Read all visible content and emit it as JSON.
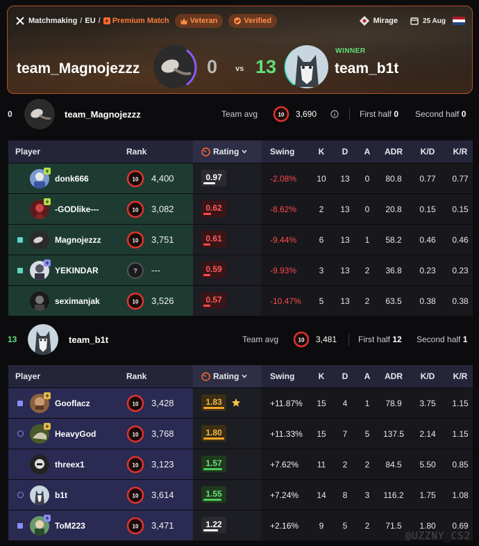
{
  "breadcrumb": {
    "items": [
      "Matchmaking",
      "EU"
    ],
    "premium": "Premium Match",
    "badges": [
      "Veteran",
      "Verified"
    ]
  },
  "match_info": {
    "map": "Mirage",
    "date": "25 Aug",
    "region_flag": "netherlands-flag"
  },
  "scoreboard": {
    "team1_name": "team_Magnojezzz",
    "team1_score": "0",
    "vs": "vs",
    "team2_name": "team_b1t",
    "team2_score": "13",
    "winner_label": "WINNER"
  },
  "team1": {
    "score": "0",
    "name": "team_Magnojezzz",
    "avg_label": "Team avg",
    "avg_level": "10",
    "avg_value": "3,690",
    "first_half_label": "First half",
    "first_half": "0",
    "second_half_label": "Second half",
    "second_half": "0"
  },
  "team2": {
    "score": "13",
    "name": "team_b1t",
    "avg_label": "Team avg",
    "avg_level": "10",
    "avg_value": "3,481",
    "first_half_label": "First half",
    "first_half": "12",
    "second_half_label": "Second half",
    "second_half": "1"
  },
  "columns": {
    "player": "Player",
    "rank": "Rank",
    "rating": "Rating",
    "swing": "Swing",
    "k": "K",
    "d": "D",
    "a": "A",
    "adr": "ADR",
    "kd": "K/D",
    "kr": "K/R"
  },
  "team1_players": [
    {
      "name": "donk666",
      "level": "10",
      "elo": "4,400",
      "rating": "0.97",
      "rating_fraction": 0.55,
      "swing": "-2.08%",
      "k": "10",
      "d": "13",
      "a": "0",
      "adr": "80.8",
      "kd": "0.77",
      "kr": "0.77"
    },
    {
      "name": "-GODlike---",
      "level": "10",
      "elo": "3,082",
      "rating": "0.62",
      "rating_fraction": 0.35,
      "swing": "-8.62%",
      "k": "2",
      "d": "13",
      "a": "0",
      "adr": "20.8",
      "kd": "0.15",
      "kr": "0.15"
    },
    {
      "name": "Magnojezzz",
      "level": "10",
      "elo": "3,751",
      "rating": "0.61",
      "rating_fraction": 0.34,
      "swing": "-9.44%",
      "k": "6",
      "d": "13",
      "a": "1",
      "adr": "58.2",
      "kd": "0.46",
      "kr": "0.46"
    },
    {
      "name": "YEKINDAR",
      "level": "?",
      "elo": "---",
      "rating": "0.59",
      "rating_fraction": 0.33,
      "swing": "-9.93%",
      "k": "3",
      "d": "13",
      "a": "2",
      "adr": "36.8",
      "kd": "0.23",
      "kr": "0.23"
    },
    {
      "name": "seximanjak",
      "level": "10",
      "elo": "3,526",
      "rating": "0.57",
      "rating_fraction": 0.32,
      "swing": "-10.47%",
      "k": "5",
      "d": "13",
      "a": "2",
      "adr": "63.5",
      "kd": "0.38",
      "kr": "0.38"
    }
  ],
  "team2_players": [
    {
      "name": "Gooflacz",
      "level": "10",
      "elo": "3,428",
      "rating": "1.83",
      "rating_fraction": 1.0,
      "swing": "+11.87%",
      "k": "15",
      "d": "4",
      "a": "1",
      "adr": "78.9",
      "kd": "3.75",
      "kr": "1.15"
    },
    {
      "name": "HeavyGod",
      "level": "10",
      "elo": "3,768",
      "rating": "1.80",
      "rating_fraction": 1.0,
      "swing": "+11.33%",
      "k": "15",
      "d": "7",
      "a": "5",
      "adr": "137.5",
      "kd": "2.14",
      "kr": "1.15"
    },
    {
      "name": "threex1",
      "level": "10",
      "elo": "3,123",
      "rating": "1.57",
      "rating_fraction": 0.9,
      "swing": "+7.62%",
      "k": "11",
      "d": "2",
      "a": "2",
      "adr": "84.5",
      "kd": "5.50",
      "kr": "0.85"
    },
    {
      "name": "b1t",
      "level": "10",
      "elo": "3,614",
      "rating": "1.55",
      "rating_fraction": 0.88,
      "swing": "+7.24%",
      "k": "14",
      "d": "8",
      "a": "3",
      "adr": "116.2",
      "kd": "1.75",
      "kr": "1.08"
    },
    {
      "name": "ToM223",
      "level": "10",
      "elo": "3,471",
      "rating": "1.22",
      "rating_fraction": 0.7,
      "swing": "+2.16%",
      "k": "9",
      "d": "5",
      "a": "2",
      "adr": "71.5",
      "kd": "1.80",
      "kr": "0.69"
    }
  ],
  "watermark": "@UZZNY_CS2",
  "colors": {
    "accent": "#ff6a2a",
    "winner": "#5fe07a",
    "negative": "#ff4a4a",
    "team1_row": "#1e3b32",
    "team2_row": "#2a2a52"
  }
}
